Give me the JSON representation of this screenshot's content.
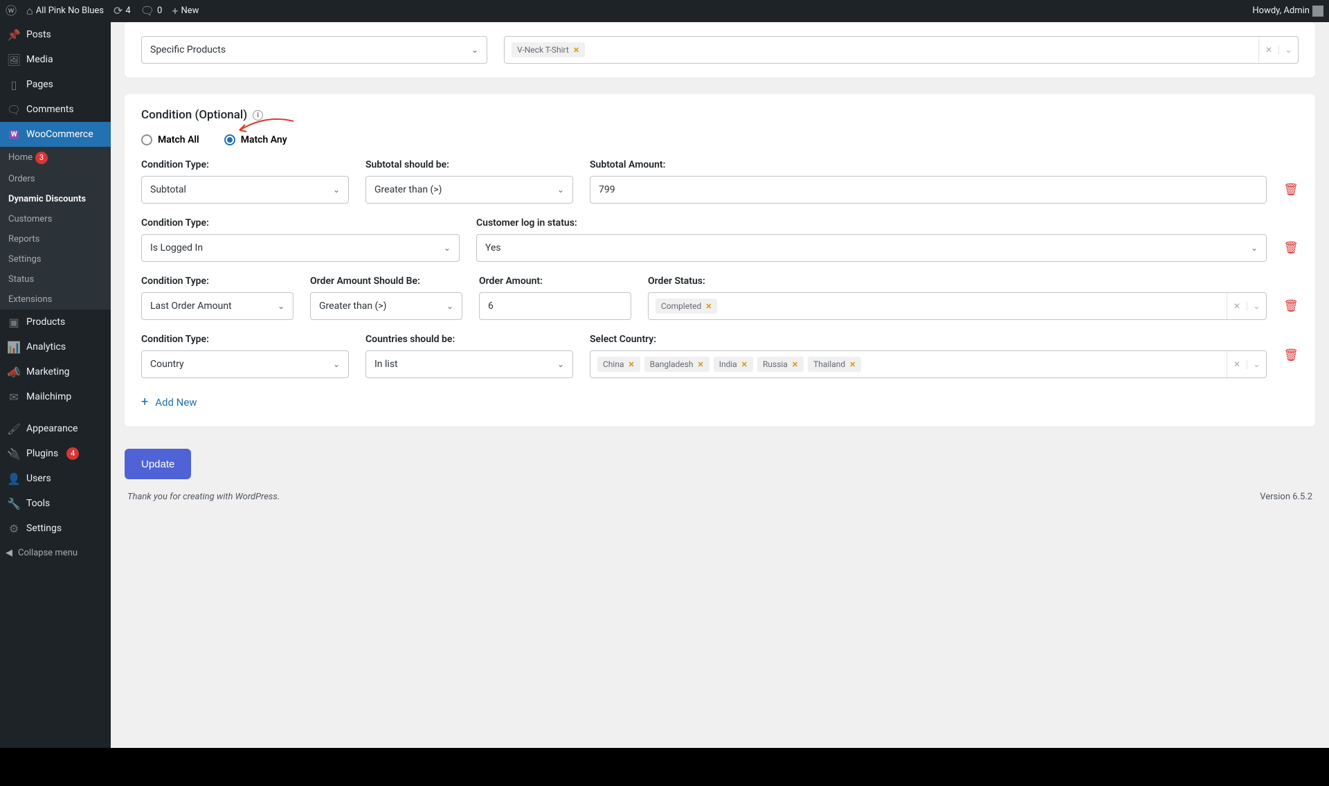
{
  "adminbar": {
    "site_name": "All Pink No Blues",
    "updates_count": "4",
    "comments_count": "0",
    "new_label": "New",
    "howdy": "Howdy, Admin"
  },
  "sidebar": {
    "posts": "Posts",
    "media": "Media",
    "pages": "Pages",
    "comments": "Comments",
    "woocommerce": "WooCommerce",
    "woo_sub": {
      "home": "Home",
      "home_badge": "3",
      "orders": "Orders",
      "dynamic_discounts": "Dynamic Discounts",
      "customers": "Customers",
      "reports": "Reports",
      "settings": "Settings",
      "status": "Status",
      "extensions": "Extensions"
    },
    "products": "Products",
    "analytics": "Analytics",
    "marketing": "Marketing",
    "mailchimp": "Mailchimp",
    "appearance": "Appearance",
    "plugins": "Plugins",
    "plugins_badge": "4",
    "users": "Users",
    "tools": "Tools",
    "settings2": "Settings",
    "collapse": "Collapse menu"
  },
  "top_card": {
    "select_value": "Specific Products",
    "tag_product": "V-Neck T-Shirt"
  },
  "condition": {
    "title": "Condition (Optional)",
    "match_all": "Match All",
    "match_any": "Match Any"
  },
  "row1": {
    "type_label": "Condition Type:",
    "type_value": "Subtotal",
    "op_label": "Subtotal should be:",
    "op_value": "Greater than (>)",
    "amount_label": "Subtotal Amount:",
    "amount_value": "799"
  },
  "row2": {
    "type_label": "Condition Type:",
    "type_value": "Is Logged In",
    "status_label": "Customer log in status:",
    "status_value": "Yes"
  },
  "row3": {
    "type_label": "Condition Type:",
    "type_value": "Last Order Amount",
    "op_label": "Order Amount Should Be:",
    "op_value": "Greater than (>)",
    "amount_label": "Order Amount:",
    "amount_value": "6",
    "status_label": "Order Status:",
    "status_tag": "Completed"
  },
  "row4": {
    "type_label": "Condition Type:",
    "type_value": "Country",
    "op_label": "Countries should be:",
    "op_value": "In list",
    "select_label": "Select Country:",
    "tags": {
      "china": "China",
      "bangladesh": "Bangladesh",
      "india": "India",
      "russia": "Russia",
      "thailand": "Thailand"
    }
  },
  "add_new": "Add New",
  "update": "Update",
  "footer": {
    "thanks": "Thank you for creating with WordPress.",
    "version": "Version 6.5.2"
  }
}
